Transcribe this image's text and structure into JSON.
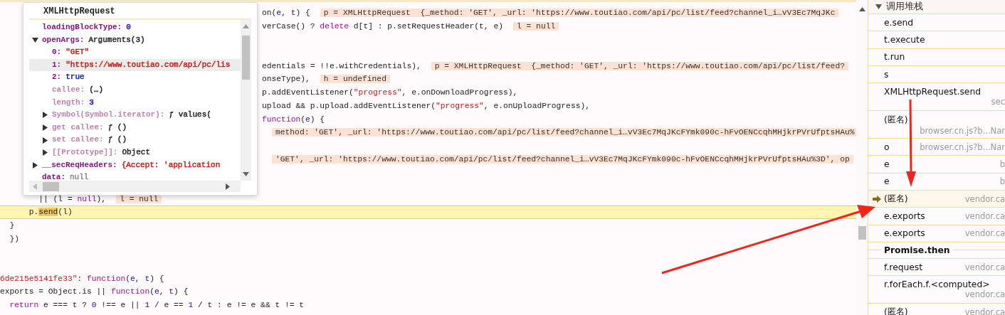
{
  "editor": {
    "lines": [
      {
        "kind": "clipped",
        "segments": [
          {
            "kind": "plain",
            "text": "on("
          },
          {
            "kind": "param",
            "text": "e"
          },
          {
            "kind": "plain",
            "text": ", "
          },
          {
            "kind": "param",
            "text": "t"
          },
          {
            "kind": "plain",
            "text": ") {"
          },
          {
            "kind": "hint",
            "text": "p = XMLHttpRequest  {_method: 'GET', _url: 'https://www.toutiao.com/api/pc/list/feed?channel_i…vV3Ec7MqJKc"
          }
        ]
      },
      {
        "kind": "clipped",
        "segments": [
          {
            "kind": "plain",
            "text": "verCase() ? "
          },
          {
            "kind": "kw",
            "text": "delete"
          },
          {
            "kind": "plain",
            "text": " d[t] : p.setRequestHeader(t, e)"
          },
          {
            "kind": "hint",
            "text": "l = null"
          }
        ]
      },
      {
        "kind": "blank"
      },
      {
        "kind": "blank"
      },
      {
        "kind": "clipped",
        "segments": [
          {
            "kind": "plain",
            "text": "edentials = !!e.withCredentials),"
          },
          {
            "kind": "hint",
            "text": "p = XMLHttpRequest  {_method: 'GET', _url: 'https://www.toutiao.com/api/pc/list/feed?"
          }
        ]
      },
      {
        "kind": "clipped",
        "segments": [
          {
            "kind": "plain",
            "text": "onseType),"
          },
          {
            "kind": "hint",
            "text": "h = undefined"
          }
        ]
      },
      {
        "kind": "clipped",
        "segments": [
          {
            "kind": "plain",
            "text": "p.addEventListener("
          },
          {
            "kind": "str",
            "text": "\"progress\""
          },
          {
            "kind": "plain",
            "text": ", e.onDownloadProgress),"
          }
        ]
      },
      {
        "kind": "clipped",
        "segments": [
          {
            "kind": "plain",
            "text": "upload && p.upload.addEventListener("
          },
          {
            "kind": "str",
            "text": "\"progress\""
          },
          {
            "kind": "plain",
            "text": ", e.onUploadProgress),"
          }
        ]
      },
      {
        "kind": "clipped",
        "segments": [
          {
            "kind": "kw",
            "text": "function"
          },
          {
            "kind": "plain",
            "text": "("
          },
          {
            "kind": "param",
            "text": "e"
          },
          {
            "kind": "plain",
            "text": ") {"
          }
        ]
      },
      {
        "kind": "clipped",
        "segments": [
          {
            "kind": "hint",
            "text": "method: 'GET', _url: 'https://www.toutiao.com/api/pc/list/feed?channel_i…vV3Ec7MqJKcFYmk090c-hFvOENCcqhMHjkrPVrUfptsHAu%"
          }
        ]
      },
      {
        "kind": "blank"
      },
      {
        "kind": "clipped",
        "segments": [
          {
            "kind": "hint",
            "text": "'GET', _url: 'https://www.toutiao.com/api/pc/list/feed?channel_i…vV3Ec7MqJKcFYmk090c-hFvOENCcqhMHjkrPVrUfptsHAu%3D', op"
          }
        ]
      },
      {
        "kind": "blank"
      },
      {
        "kind": "blank"
      },
      {
        "kind": "full",
        "segments": [
          {
            "kind": "plain",
            "text": "        || (l = "
          },
          {
            "kind": "kw",
            "text": "null"
          },
          {
            "kind": "plain",
            "text": "),"
          },
          {
            "kind": "hint",
            "text": "l = null"
          }
        ]
      },
      {
        "kind": "current",
        "segments": [
          {
            "kind": "plain",
            "text": "      p."
          },
          {
            "kind": "exec",
            "text": "send"
          },
          {
            "kind": "plain",
            "text": "(l)"
          }
        ]
      },
      {
        "kind": "full",
        "segments": [
          {
            "kind": "plain",
            "text": "  }"
          }
        ]
      },
      {
        "kind": "full",
        "segments": [
          {
            "kind": "plain",
            "text": "  })"
          }
        ]
      },
      {
        "kind": "blank"
      },
      {
        "kind": "blank"
      },
      {
        "kind": "full",
        "segments": [
          {
            "kind": "str",
            "text": "6de215e5141fe33\""
          },
          {
            "kind": "plain",
            "text": ": "
          },
          {
            "kind": "kw",
            "text": "function"
          },
          {
            "kind": "plain",
            "text": "("
          },
          {
            "kind": "param",
            "text": "e"
          },
          {
            "kind": "plain",
            "text": ", "
          },
          {
            "kind": "param",
            "text": "t"
          },
          {
            "kind": "plain",
            "text": ") {"
          }
        ]
      },
      {
        "kind": "full",
        "segments": [
          {
            "kind": "plain",
            "text": "exports = Object.is || "
          },
          {
            "kind": "kw",
            "text": "function"
          },
          {
            "kind": "plain",
            "text": "("
          },
          {
            "kind": "param",
            "text": "e"
          },
          {
            "kind": "plain",
            "text": ", "
          },
          {
            "kind": "param",
            "text": "t"
          },
          {
            "kind": "plain",
            "text": ") {"
          }
        ]
      },
      {
        "kind": "full",
        "segments": [
          {
            "kind": "kw",
            "text": "  return"
          },
          {
            "kind": "plain",
            "text": " e === t ? "
          },
          {
            "kind": "num",
            "text": "0"
          },
          {
            "kind": "plain",
            "text": " !== e || "
          },
          {
            "kind": "num",
            "text": "1"
          },
          {
            "kind": "plain",
            "text": " / e == "
          },
          {
            "kind": "num",
            "text": "1"
          },
          {
            "kind": "plain",
            "text": " / t : e != e && t != t"
          }
        ]
      }
    ]
  },
  "popover": {
    "title": "XMLHttpRequest",
    "items": [
      {
        "kind": "leaf",
        "name": "loadingBlockType:",
        "value": "0",
        "color": "#1c00cf",
        "dimmed": false,
        "selected": false
      },
      {
        "kind": "group",
        "expanded": true,
        "name": "openArgs:",
        "value": "Arguments(3)",
        "color": "#222222",
        "dimmed": false,
        "selected": false,
        "children": [
          {
            "kind": "leaf",
            "name": "0:",
            "value": "\"GET\"",
            "color": "#c41a16",
            "dimmed": false,
            "selected": false
          },
          {
            "kind": "leaf",
            "name": "1:",
            "value": "\"https://www.toutiao.com/api/pc/lis",
            "color": "#c41a16",
            "dimmed": false,
            "selected": true
          },
          {
            "kind": "leaf",
            "name": "2:",
            "value": "true",
            "color": "#0d22aa",
            "dimmed": false,
            "selected": false
          },
          {
            "kind": "leaf",
            "name": "callee:",
            "value": "(…)",
            "color": "#222222",
            "dimmed": true,
            "selected": false
          },
          {
            "kind": "leaf",
            "name": "length:",
            "value": "3",
            "color": "#1c00cf",
            "dimmed": true,
            "selected": false
          },
          {
            "kind": "group",
            "expanded": false,
            "name": "Symbol(Symbol.iterator):",
            "value": "ƒ values(",
            "color": "#222222",
            "dimmed": true,
            "selected": false
          },
          {
            "kind": "group",
            "expanded": false,
            "name": "get callee:",
            "value": "ƒ ()",
            "color": "#222222",
            "dimmed": true,
            "selected": false
          },
          {
            "kind": "group",
            "expanded": false,
            "name": "set callee:",
            "value": "ƒ ()",
            "color": "#222222",
            "dimmed": true,
            "selected": false
          },
          {
            "kind": "group",
            "expanded": false,
            "name": "[[Prototype]]:",
            "value": "Object",
            "color": "#222222",
            "dimmed": true,
            "selected": false
          }
        ]
      },
      {
        "kind": "group",
        "expanded": false,
        "name": "__secReqHeaders:",
        "value": "{Accept: 'application",
        "color": "#c41a16",
        "dimmed": false,
        "selected": false
      },
      {
        "kind": "leaf",
        "name": "data:",
        "value": "null",
        "color": "#888888",
        "dimmed": false,
        "selected": false
      }
    ]
  },
  "call_stack": {
    "title": "调用堆栈",
    "expanded": true,
    "frames": [
      {
        "kind": "frame",
        "name": "e.send",
        "wrap": false,
        "selected": false
      },
      {
        "kind": "frame",
        "name": "t.execute",
        "wrap": false,
        "selected": false
      },
      {
        "kind": "frame",
        "name": "t.run",
        "wrap": false,
        "selected": false
      },
      {
        "kind": "frame",
        "name": "s",
        "wrap": false,
        "selected": false
      },
      {
        "kind": "frame",
        "name": "XMLHttpRequest.send",
        "location": "sec",
        "wrap": true,
        "selected": false
      },
      {
        "kind": "frame",
        "name": "(匿名)",
        "location": "browser.cn.js?b...Nar",
        "wrap": true,
        "selected": false
      },
      {
        "kind": "frame",
        "name": "o",
        "location": "browser.cn.js?b...Nar",
        "wrap": false,
        "selected": false
      },
      {
        "kind": "frame",
        "name": "e",
        "location": "b",
        "wrap": false,
        "selected": false
      },
      {
        "kind": "frame",
        "name": "e",
        "location": "b",
        "wrap": false,
        "selected": false
      },
      {
        "kind": "frame",
        "name": "(匿名)",
        "location": "vendor.ca",
        "wrap": false,
        "selected": true
      },
      {
        "kind": "frame",
        "name": "e.exports",
        "location": "vendor.ca",
        "wrap": false,
        "selected": false
      },
      {
        "kind": "frame",
        "name": "e.exports",
        "location": "vendor.ca",
        "wrap": false,
        "selected": false
      },
      {
        "kind": "async",
        "name": "Promise.then"
      },
      {
        "kind": "frame",
        "name": "f.request",
        "location": "vendor.ca",
        "wrap": false,
        "selected": false
      },
      {
        "kind": "frame",
        "name": "r.forEach.f.<computed>",
        "location": "vendor.ca",
        "wrap": true,
        "selected": false
      },
      {
        "kind": "frame",
        "name": "(匿名)",
        "location": "vendor.ca",
        "wrap": false,
        "selected": false
      }
    ]
  }
}
